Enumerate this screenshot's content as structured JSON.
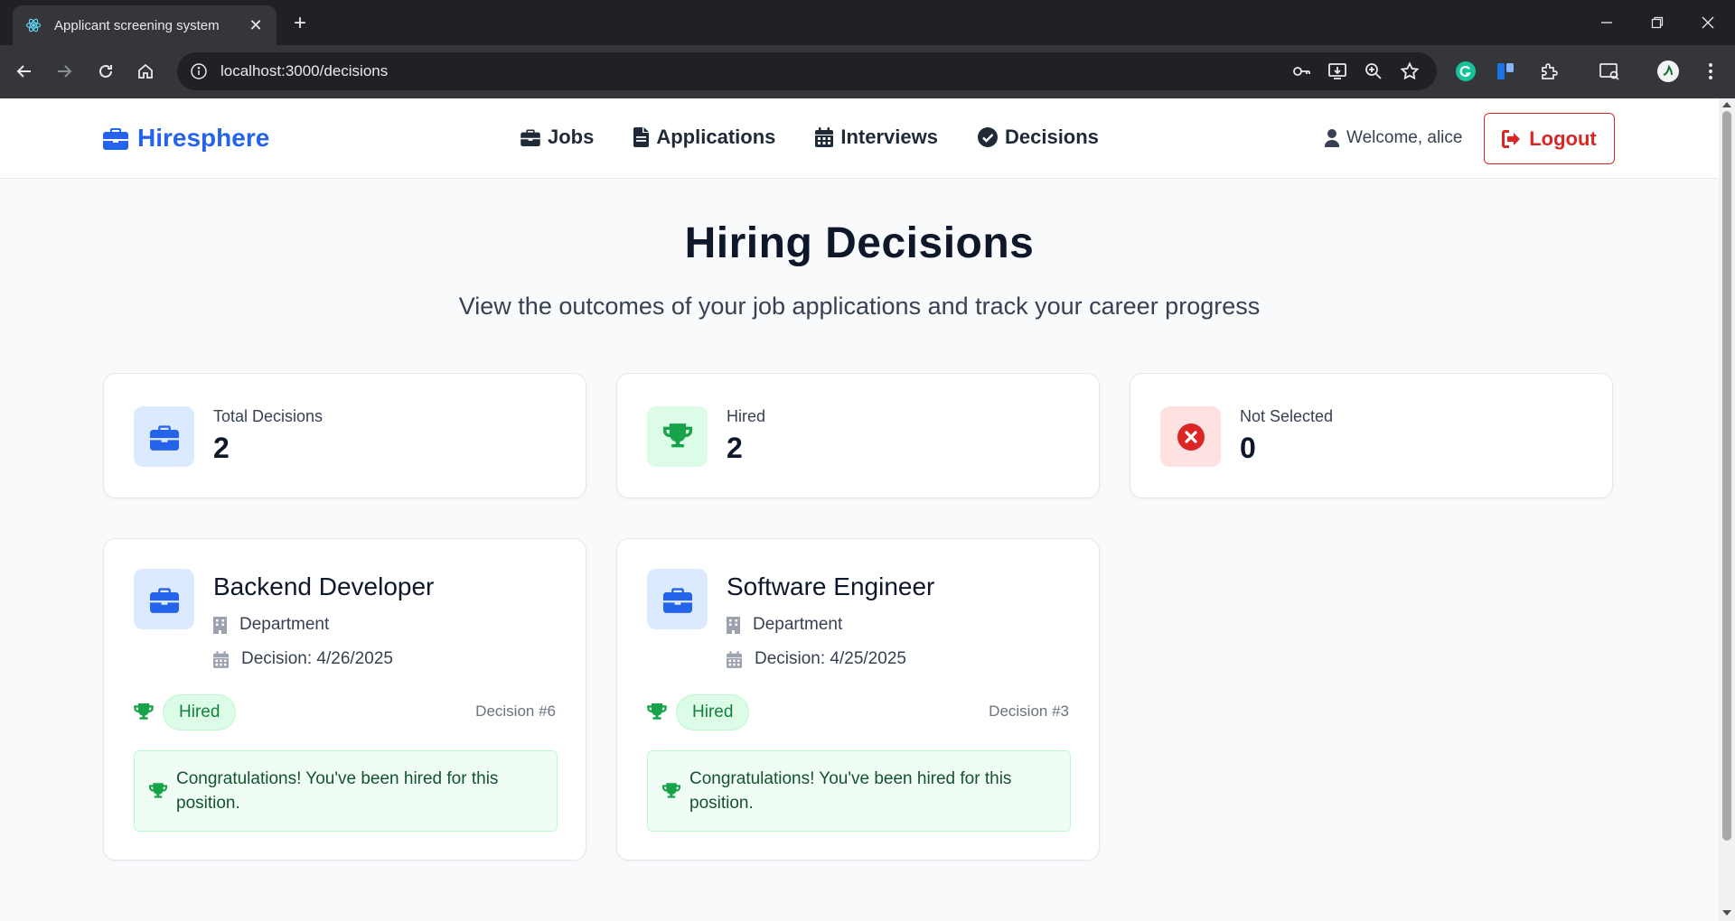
{
  "browser": {
    "tab_title": "Applicant screening system",
    "url": "localhost:3000/decisions"
  },
  "header": {
    "brand": "Hiresphere",
    "nav": [
      {
        "label": "Jobs",
        "icon": "briefcase-icon"
      },
      {
        "label": "Applications",
        "icon": "file-icon"
      },
      {
        "label": "Interviews",
        "icon": "calendar-icon"
      },
      {
        "label": "Decisions",
        "icon": "check-circle-icon"
      }
    ],
    "welcome": "Welcome, alice",
    "logout_label": "Logout"
  },
  "page": {
    "title": "Hiring Decisions",
    "subtitle": "View the outcomes of your job applications and track your career progress"
  },
  "stats": [
    {
      "label": "Total Decisions",
      "value": "2",
      "icon": "briefcase-icon",
      "color": "#2563eb"
    },
    {
      "label": "Hired",
      "value": "2",
      "icon": "trophy-icon",
      "color": "#16a34a"
    },
    {
      "label": "Not Selected",
      "value": "0",
      "icon": "x-circle-icon",
      "color": "#dc2626"
    }
  ],
  "decisions": [
    {
      "title": "Backend Developer",
      "department": "Department",
      "date": "Decision: 4/26/2025",
      "status": "Hired",
      "decision_id": "Decision #6",
      "message": "Congratulations! You've been hired for this position."
    },
    {
      "title": "Software Engineer",
      "department": "Department",
      "date": "Decision: 4/25/2025",
      "status": "Hired",
      "decision_id": "Decision #3",
      "message": "Congratulations! You've been hired for this position."
    }
  ],
  "colors": {
    "accent": "#2563eb",
    "success": "#16a34a",
    "danger": "#dc2626"
  }
}
